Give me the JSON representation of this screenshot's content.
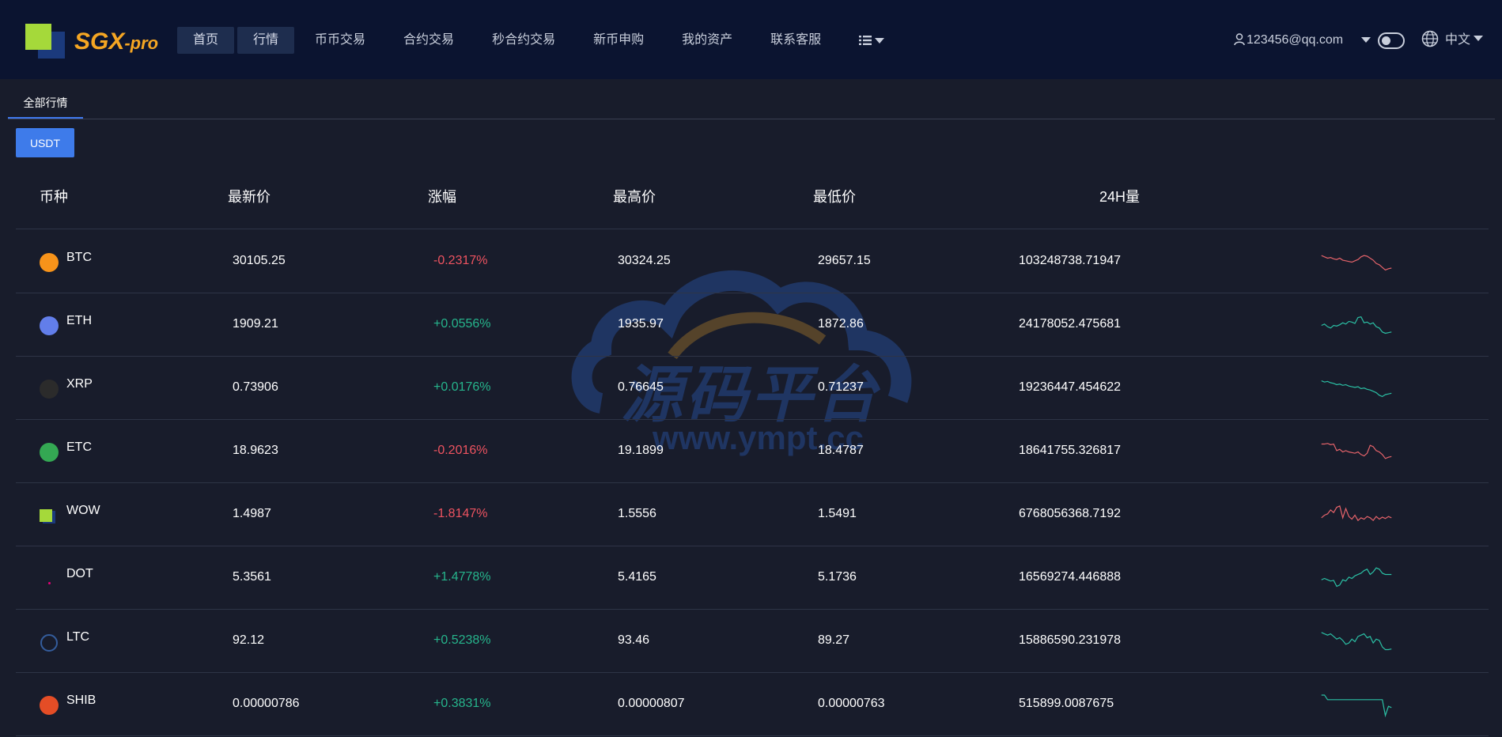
{
  "header": {
    "brand": "SGX",
    "brand_suffix": "-pro",
    "nav": [
      {
        "label": "首页",
        "active": true
      },
      {
        "label": "行情",
        "active": true
      },
      {
        "label": "币币交易",
        "active": false
      },
      {
        "label": "合约交易",
        "active": false
      },
      {
        "label": "秒合约交易",
        "active": false
      },
      {
        "label": "新币申购",
        "active": false
      },
      {
        "label": "我的资产",
        "active": false
      },
      {
        "label": "联系客服",
        "active": false
      }
    ],
    "more_icon": "list-icon",
    "user_email": "123456@qq.com",
    "language": "中文"
  },
  "tabs": {
    "all_market": "全部行情"
  },
  "quote_currency": "USDT",
  "table": {
    "headers": {
      "coin": "币种",
      "latest": "最新价",
      "change": "涨幅",
      "high": "最高价",
      "low": "最低价",
      "volume": "24H量"
    },
    "rows": [
      {
        "coin": "BTC",
        "price": "30105.25",
        "change": "-0.2317%",
        "high": "30324.25",
        "low": "29657.15",
        "volume": "103248738.71947",
        "trend": "down",
        "icon_color": "#f7931a",
        "spark": [
          8,
          10,
          12,
          11,
          13,
          14,
          12,
          15,
          16,
          17,
          18,
          16,
          14,
          10,
          8,
          9,
          12,
          15,
          20,
          22,
          26,
          30,
          28,
          27
        ]
      },
      {
        "coin": "ETH",
        "price": "1909.21",
        "change": "+0.0556%",
        "high": "1935.97",
        "low": "1872.86",
        "volume": "24178052.475681",
        "trend": "up",
        "icon_color": "#627eea",
        "spark": [
          18,
          16,
          20,
          22,
          18,
          19,
          17,
          14,
          16,
          12,
          13,
          15,
          6,
          5,
          14,
          13,
          16,
          14,
          20,
          22,
          28,
          30,
          29,
          28
        ]
      },
      {
        "coin": "XRP",
        "price": "0.73906",
        "change": "+0.0176%",
        "high": "0.76645",
        "low": "0.71237",
        "volume": "19236447.454622",
        "trend": "up",
        "icon_color": "#2b2b2b",
        "spark": [
          6,
          8,
          7,
          9,
          10,
          12,
          11,
          13,
          12,
          14,
          15,
          16,
          15,
          18,
          17,
          19,
          20,
          22,
          24,
          28,
          30,
          27,
          26,
          25
        ]
      },
      {
        "coin": "ETC",
        "price": "18.9623",
        "change": "-0.2016%",
        "high": "19.1899",
        "low": "18.4787",
        "volume": "18641755.326817",
        "trend": "down",
        "icon_color": "#34a853",
        "spark": [
          6,
          6,
          5,
          7,
          6,
          16,
          14,
          18,
          16,
          18,
          19,
          20,
          18,
          22,
          24,
          20,
          8,
          10,
          16,
          18,
          22,
          28,
          26,
          25
        ]
      },
      {
        "coin": "WOW",
        "price": "1.4987",
        "change": "-1.8147%",
        "high": "1.5556",
        "low": "1.5491",
        "volume": "6768056368.7192",
        "trend": "down",
        "icon_color": "#a5d93a",
        "spark": [
          22,
          18,
          16,
          10,
          14,
          6,
          4,
          22,
          8,
          20,
          24,
          18,
          26,
          22,
          24,
          20,
          22,
          26,
          20,
          24,
          21,
          23,
          20,
          22
        ]
      },
      {
        "coin": "DOT",
        "price": "5.3561",
        "change": "+1.4778%",
        "high": "5.4165",
        "low": "5.1736",
        "volume": "16569274.446888",
        "trend": "up",
        "icon_color": "#e6007a",
        "spark": [
          20,
          18,
          20,
          22,
          21,
          30,
          28,
          20,
          22,
          16,
          18,
          14,
          12,
          10,
          6,
          4,
          12,
          8,
          2,
          4,
          10,
          12,
          12,
          12
        ]
      },
      {
        "coin": "LTC",
        "price": "92.12",
        "change": "+0.5238%",
        "high": "93.46",
        "low": "89.27",
        "volume": "15886590.231978",
        "trend": "up",
        "icon_color": "#345d9d",
        "spark": [
          4,
          6,
          8,
          6,
          10,
          14,
          12,
          16,
          22,
          20,
          14,
          18,
          10,
          8,
          6,
          12,
          10,
          20,
          14,
          16,
          26,
          30,
          30,
          29
        ]
      },
      {
        "coin": "SHIB",
        "price": "0.00000786",
        "change": "+0.3831%",
        "high": "0.00000807",
        "low": "0.00000763",
        "volume": "515899.0087675",
        "trend": "up",
        "icon_color": "#e44d26",
        "spark": [
          3,
          3,
          10,
          10,
          10,
          10,
          10,
          10,
          10,
          10,
          10,
          10,
          10,
          10,
          10,
          10,
          10,
          10,
          10,
          10,
          10,
          34,
          20,
          22
        ]
      }
    ]
  },
  "watermark": {
    "text1": "源码平台",
    "text2": "www.ympt.cc"
  },
  "colors": {
    "up": "#26b58c",
    "down": "#ee5360",
    "accent": "#3e7bea",
    "header_bg": "#0b1430",
    "page_bg": "#181c2b"
  }
}
